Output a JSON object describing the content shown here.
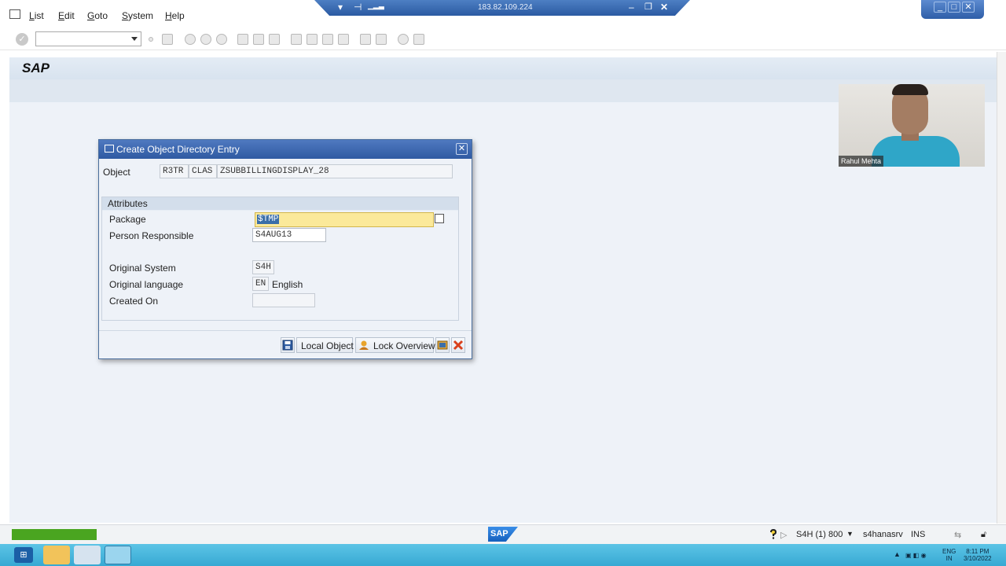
{
  "remote": {
    "ip": "183.82.109.224"
  },
  "menu": {
    "items": [
      "List",
      "Edit",
      "Goto",
      "System",
      "Help"
    ]
  },
  "titlebar": {
    "logo": "SAP"
  },
  "webcam": {
    "name": "Rahul Mehta"
  },
  "dialog": {
    "title": "Create Object Directory Entry",
    "object_label": "Object",
    "object_pgmid": "R3TR",
    "object_type": "CLAS",
    "object_name": "ZSUBBILLINGDISPLAY_28",
    "attributes_header": "Attributes",
    "package_label": "Package",
    "package_value": "$TMP",
    "person_label": "Person Responsible",
    "person_value": "S4AUG13",
    "orig_system_label": "Original System",
    "orig_system_value": "S4H",
    "orig_lang_label": "Original language",
    "orig_lang_code": "EN",
    "orig_lang_text": "English",
    "created_on_label": "Created On",
    "created_on_value": "",
    "buttons": {
      "local_object": "Local Object",
      "lock_overview": "Lock Overview"
    }
  },
  "status": {
    "system": "S4H (1) 800",
    "server": "s4hanasrv",
    "mode": "INS"
  },
  "taskbar": {
    "lang_top": "ENG",
    "lang_bottom": "IN",
    "time": "8:11 PM",
    "date": "3/10/2022"
  },
  "colors": {
    "title_blue": "#2f5aa2",
    "input_yellow": "#fbe99a",
    "progress_green": "#4aa520",
    "cancel_red": "#d9401c"
  }
}
